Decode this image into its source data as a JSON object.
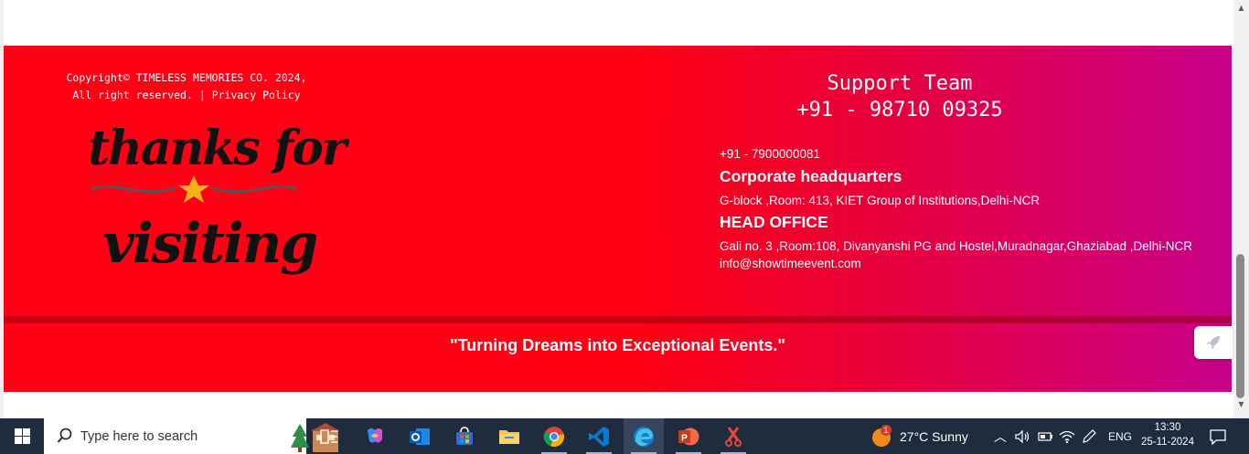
{
  "footer": {
    "copyright_line1": "Copyright© TIMELESS MEMORIES CO. 2024,",
    "copyright_line2_prefix": "All right reserved. | ",
    "privacy_link": "Privacy Policy",
    "thanks_line1": "thanks for",
    "thanks_line2": "visiting",
    "support_title": "Support Team",
    "support_phone": "+91 - 98710 09325",
    "secondary_phone": "+91 - 7900000081",
    "corporate_heading": "Corporate headquarters",
    "corporate_address": "G-block ,Room: 413, KIET Group of Institutions,Delhi-NCR",
    "head_office_heading": "HEAD OFFICE",
    "head_office_address": "Gali no. 3 ,Room:108, Divanyanshi PG and Hostel,Muradnagar,Ghaziabad ,Delhi-NCR",
    "email": "info@showtimeevent.com",
    "tagline": "\"Turning Dreams into Exceptional Events.\"",
    "colors": {
      "red": "#ff0014",
      "magenta": "#c7008a"
    }
  },
  "taskbar": {
    "search_placeholder": "Type here to search",
    "apps": [
      "task-view",
      "copilot",
      "outlook",
      "microsoft-store",
      "file-explorer",
      "chrome",
      "vscode",
      "edge",
      "powerpoint",
      "snipping-tool"
    ],
    "weather_badge": "1",
    "weather": "27°C  Sunny",
    "language": "ENG",
    "time": "13:30",
    "date": "25-11-2024"
  }
}
